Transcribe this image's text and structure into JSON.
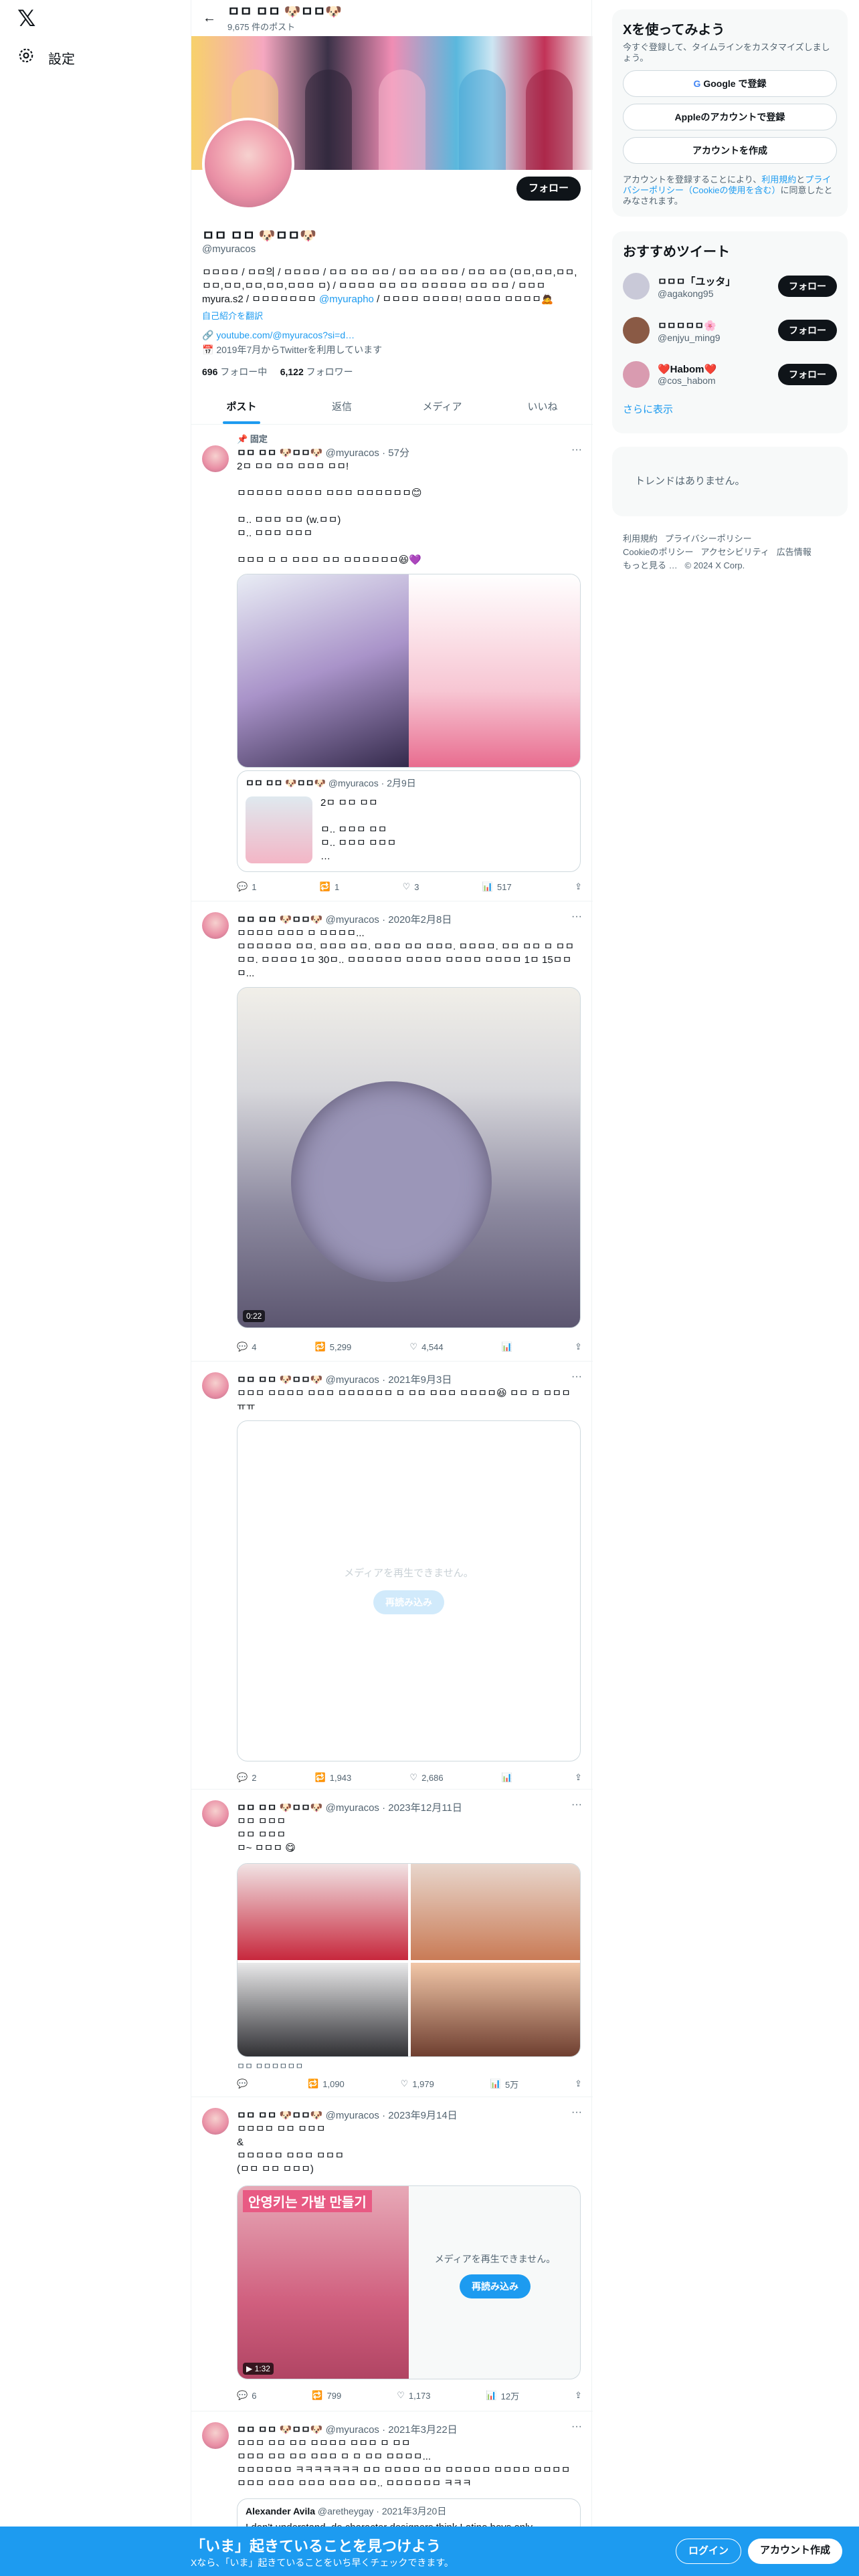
{
  "nav": {
    "logo": "𝕏",
    "settings": "設定",
    "settings_icon": "gear-icon"
  },
  "header": {
    "name": "ㅁㅁ ㅁㅁ 🐶ㅁㅁ🐶",
    "posts_count": "9,675 件のポスト"
  },
  "profile": {
    "name": "ㅁㅁ ㅁㅁ 🐶ㅁㅁ🐶",
    "handle": "@myuracos",
    "follow_label": "フォロー",
    "bio": "ㅁㅁㅁㅁ / ㅁㅁ의 / ㅁㅁㅁㅁ / ㅁㅁ ㅁㅁ ㅁㅁ / ㅁㅁ ㅁㅁ ㅁㅁ / ㅁㅁ ㅁㅁ (ㅁㅁ,ㅁㅁ,ㅁㅁ,ㅁㅁ,ㅁㅁ,ㅁㅁ,ㅁㅁ,ㅁㅁㅁ ㅁ) / ㅁㅁㅁㅁ ㅁㅁ ㅁㅁ ㅁㅁㅁㅁㅁ ㅁㅁ ㅁㅁ / ㅁㅁㅁ myura.s2 / ㅁㅁㅁㅁㅁㅁㅁ",
    "bio_link": "@myurapho",
    "bio_tail": "/ ㅁㅁㅁㅁ ㅁㅁㅁㅁ! ㅁㅁㅁㅁ ㅁㅁㅁㅁ🙇",
    "translate": "自己紹介を翻訳",
    "link": "youtube.com/@myuracos?si=d…",
    "joined": "2019年7月からTwitterを利用しています",
    "following_count": "696",
    "following_label": "フォロー中",
    "followers_count": "6,122",
    "followers_label": "フォロワー"
  },
  "tabs": [
    "ポスト",
    "返信",
    "メディア",
    "いいね"
  ],
  "tweets": [
    {
      "pinned": "固定",
      "name": "ㅁㅁ ㅁㅁ 🐶ㅁㅁ🐶",
      "handle": "@myuracos",
      "time": "57分",
      "text": "2ㅁ ㅁㅁ ㅁㅁ ㅁㅁㅁ ㅁㅁ!\n\nㅁㅁㅁㅁㅁ ㅁㅁㅁㅁ ㅁㅁㅁ ㅁㅁㅁㅁㅁㅁ😊\n\nㅁ.. ㅁㅁㅁ ㅁㅁ (w.ㅁㅁ)\nㅁ.. ㅁㅁㅁ ㅁㅁㅁ\n\nㅁㅁㅁ ㅁ ㅁ ㅁㅁㅁ ㅁㅁ ㅁㅁㅁㅁㅁㅁ😆💜",
      "quote_name": "ㅁㅁ ㅁㅁ 🐶ㅁㅁ🐶",
      "quote_handle": "@myuracos",
      "quote_time": "2月9日",
      "quote_text": "2ㅁ ㅁㅁ ㅁㅁ\n\nㅁ.. ㅁㅁㅁ ㅁㅁ\nㅁ.. ㅁㅁㅁ ㅁㅁㅁ\n…",
      "replies": "1",
      "retweets": "1",
      "likes": "3",
      "views": "517"
    },
    {
      "name": "ㅁㅁ ㅁㅁ 🐶ㅁㅁ🐶",
      "handle": "@myuracos",
      "time": "2020年2月8日",
      "text": "ㅁㅁㅁㅁ ㅁㅁㅁ ㅁ ㅁㅁㅁㅁ...\nㅁㅁㅁㅁㅁㅁ ㅁㅁ. ㅁㅁㅁ ㅁㅁ. ㅁㅁㅁ ㅁㅁ ㅁㅁㅁ. ㅁㅁㅁㅁ. ㅁㅁ ㅁㅁ ㅁ ㅁㅁ ㅁㅁ. ㅁㅁㅁㅁ 1ㅁ 30ㅁ.. ㅁㅁㅁㅁㅁㅁ ㅁㅁㅁㅁ ㅁㅁㅁㅁ ㅁㅁㅁㅁ 1ㅁ 15ㅁㅁㅁ...",
      "video_time": "0:22",
      "replies": "4",
      "retweets": "5,299",
      "likes": "4,544",
      "views": ""
    },
    {
      "name": "ㅁㅁ ㅁㅁ 🐶ㅁㅁ🐶",
      "handle": "@myuracos",
      "time": "2021年9月3日",
      "text": "ㅁㅁㅁ ㅁㅁㅁㅁ ㅁㅁㅁ ㅁㅁㅁㅁㅁㅁ ㅁ ㅁㅁ ㅁㅁㅁ ㅁㅁㅁㅁ😆 ㅁㅁ ㅁ ㅁㅁㅁ ㅠㅠ",
      "media_unavailable": "メディアを再生できません。",
      "reload": "再読み込み",
      "replies": "2",
      "retweets": "1,943",
      "likes": "2,686",
      "views": ""
    },
    {
      "name": "ㅁㅁ ㅁㅁ 🐶ㅁㅁ🐶",
      "handle": "@myuracos",
      "time": "2023年12月11日",
      "text": "ㅁㅁ ㅁㅁㅁ\nㅁㅁ ㅁㅁㅁ\nㅁ~ ㅁㅁㅁ 😋",
      "alt_caption": "ㅁㅁ ㅁㅁㅁㅁㅁㅁ",
      "replies": "",
      "retweets": "1,090",
      "likes": "1,979",
      "views": "5万"
    },
    {
      "name": "ㅁㅁ ㅁㅁ 🐶ㅁㅁ🐶",
      "handle": "@myuracos",
      "time": "2023年9月14日",
      "text": "ㅁㅁㅁㅁ ㅁㅁ ㅁㅁㅁ\n&\nㅁㅁㅁㅁㅁ ㅁㅁㅁ ㅁㅁㅁ\n(ㅁㅁ ㅁㅁ ㅁㅁㅁ)",
      "video_title": "안영키는 가발 만들기",
      "video_time": "1:32",
      "media_unavailable": "メディアを再生できません。",
      "reload": "再読み込み",
      "replies": "6",
      "retweets": "799",
      "likes": "1,173",
      "views": "12万"
    },
    {
      "name": "ㅁㅁ ㅁㅁ 🐶ㅁㅁ🐶",
      "handle": "@myuracos",
      "time": "2021年3月22日",
      "text": "ㅁㅁㅁ ㅁㅁ ㅁㅁ ㅁㅁㅁㅁ ㅁㅁㅁ ㅁ ㅁㅁ\nㅁㅁㅁ ㅁㅁ ㅁㅁ ㅁㅁㅁ ㅁ ㅁ ㅁㅁ ㅁㅁㅁㅁ...\nㅁㅁㅁㅁㅁㅁ ㅋㅋㅋㅋㅋㅋㅋ ㅁㅁ ㅁㅁㅁㅁ ㅁㅁ ㅁㅁㅁㅁㅁ ㅁㅁㅁㅁ ㅁㅁㅁㅁ ㅁㅁㅁ ㅁㅁㅁ ㅁㅁㅁ ㅁㅁㅁ ㅁㅁ.. ㅁㅁㅁㅁㅁㅁ ㅋㅋㅋ",
      "quote_name": "Alexander Avila",
      "quote_handle": "@aretheygay",
      "quote_time": "2021年3月20日",
      "quote_text": "I don't understand, do character designers think Latino boys only"
    }
  ],
  "right": {
    "signup_title": "Xを使ってみよう",
    "signup_sub": "今すぐ登録して、タイムラインをカスタマイズしましょう。",
    "google": "Google で登録",
    "apple": "Appleのアカウントで登録",
    "create": "アカウントを作成",
    "terms_a": "アカウントを登録することにより、",
    "terms_link1": "利用規約",
    "terms_b": "と",
    "terms_link2": "プライバシーポリシー（Cookieの使用を含む）",
    "terms_c": "に同意したとみなされます。",
    "reco_title": "おすすめツイート",
    "recos": [
      {
        "name": "ㅁㅁㅁ「ユッタ」",
        "handle": "@agakong95",
        "btn": "フォロー",
        "color": "#c9c9d8"
      },
      {
        "name": "ㅁㅁㅁㅁㅁ🌸",
        "handle": "@enjyu_ming9",
        "btn": "フォロー",
        "color": "#8a5a45"
      },
      {
        "name": "❤️Habom❤️",
        "handle": "@cos_habom",
        "btn": "フォロー",
        "color": "#d99bb0"
      }
    ],
    "more": "さらに表示",
    "trends_empty": "トレンドはありません。",
    "footer": [
      "利用規約",
      "プライバシーポリシー",
      "Cookieのポリシー",
      "アクセシビリティ",
      "広告情報",
      "もっと見る …",
      "© 2024 X Corp."
    ]
  },
  "bottom": {
    "title": "「いま」起きていることを見つけよう",
    "sub": "Xなら、「いま」起きていることをいち早くチェックできます。",
    "login": "ログイン",
    "signup": "アカウント作成"
  },
  "colors": {
    "accent": "#1d9bf0",
    "text": "#0f1419",
    "muted": "#536471"
  }
}
